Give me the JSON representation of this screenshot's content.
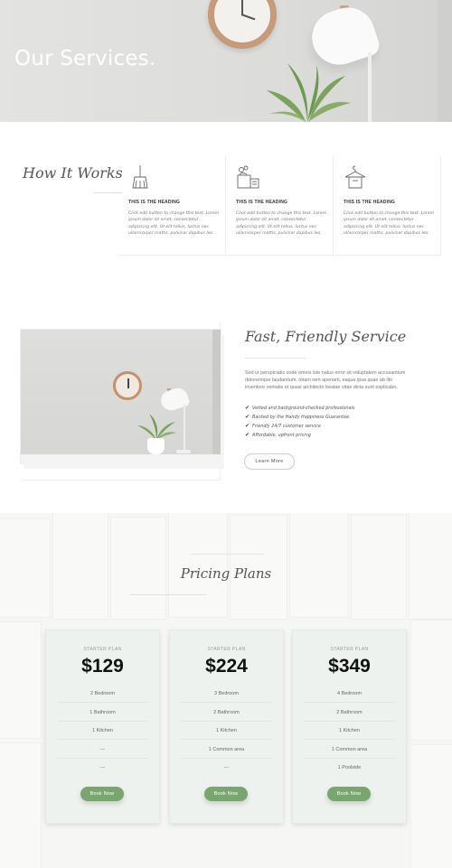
{
  "hero": {
    "title": "Our Services."
  },
  "how_it_works": {
    "title": "How It Works",
    "steps": [
      {
        "icon": "broom-icon",
        "heading": "THIS IS THE HEADING",
        "text": "Click edit button to change this text. Lorem ipsum dolor sit amet, consectetur adipiscing elit. Ut elit tellus, luctus nec ullamcorper mattis, pulvinar dapibus leo."
      },
      {
        "icon": "cleaning-bucket-icon",
        "heading": "THIS IS THE HEADING",
        "text": "Click edit button to change this text. Lorem ipsum dolor sit amet, consectetur adipiscing elit. Ut elit tellus, luctus nec ullamcorper mattis, pulvinar dapibus leo."
      },
      {
        "icon": "shirt-hanger-icon",
        "heading": "THIS IS THE HEADING",
        "text": "Click edit button to change this text. Lorem ipsum dolor sit amet, consectetur adipiscing elit. Ut elit tellus, luctus nec ullamcorper mattis, pulvinar dapibus leo."
      }
    ]
  },
  "fast_friendly": {
    "title": "Fast, Friendly Service",
    "paragraph": "Sed ut perspiciatis unde omnis iste natus error sit voluptatem accusantium doloremque laudantium, totam rem aperiam, eaque ipsa quae ab illo inventore veritatis et quasi architecto beatae vitae dicta sunt explicabo.",
    "list": [
      "Vetted and background-checked professionals",
      "Backed by the Handy Happiness Guarantee.",
      "Friendly 24/7 customer service",
      "Affordable, upfront pricing"
    ],
    "check_glyph": "✔",
    "button": "Learn More"
  },
  "pricing": {
    "title": "Pricing Plans",
    "plans": [
      {
        "plan": "STARTER PLAN",
        "price": "$129",
        "features": [
          "2 Bedroom",
          "1 Bathroom",
          "1 Kitchen",
          "---",
          "---"
        ],
        "button": "Book Now"
      },
      {
        "plan": "STARTER PLAN",
        "price": "$224",
        "features": [
          "3 Bedroom",
          "2 Bathroom",
          "1 Kitchen",
          "1 Common area",
          "---"
        ],
        "button": "Book Now"
      },
      {
        "plan": "STARTER PLAN",
        "price": "$349",
        "features": [
          "4 Bedroom",
          "2 Bathroom",
          "1 Kitchen",
          "1 Common area",
          "1 Poolside"
        ],
        "button": "Book Now"
      }
    ]
  },
  "colors": {
    "accent_green": "#79a56f",
    "heading_gray": "#555555",
    "card_bg": "#eef2ee"
  }
}
